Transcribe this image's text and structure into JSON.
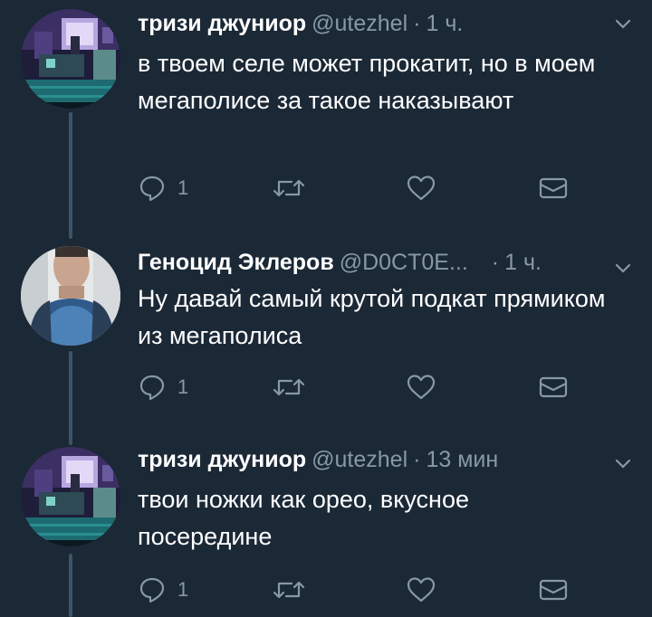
{
  "tweets": [
    {
      "name": "тризи джуниор",
      "handle": "@utezhel",
      "separator": "·",
      "time": "1 ч.",
      "text": "в твоем селе может прокатит, но в моем мегаполисе за такое наказывают",
      "reply_count": "1",
      "avatar": "pixel-art-room-avatar"
    },
    {
      "name": "Геноцид Эклеров",
      "handle": "@D0CT0E...",
      "separator": "·",
      "time": "1 ч.",
      "text": "Ну давай самый крутой подкат прямиком из мегаполиса",
      "reply_count": "1",
      "avatar": "man-in-blue-sweater-avatar"
    },
    {
      "name": "тризи джуниор",
      "handle": "@utezhel",
      "separator": "·",
      "time": "13 мин",
      "text": "твои ножки как орео, вкусное посередине",
      "reply_count": "1",
      "avatar": "pixel-art-room-avatar"
    }
  ],
  "colors": {
    "background": "#1b2836",
    "secondary_text": "#8899a6",
    "thread_line": "#3d5466",
    "primary_text": "#ffffff"
  },
  "icons": [
    "reply-icon",
    "retweet-icon",
    "like-icon",
    "direct-message-icon",
    "chevron-down-icon"
  ]
}
